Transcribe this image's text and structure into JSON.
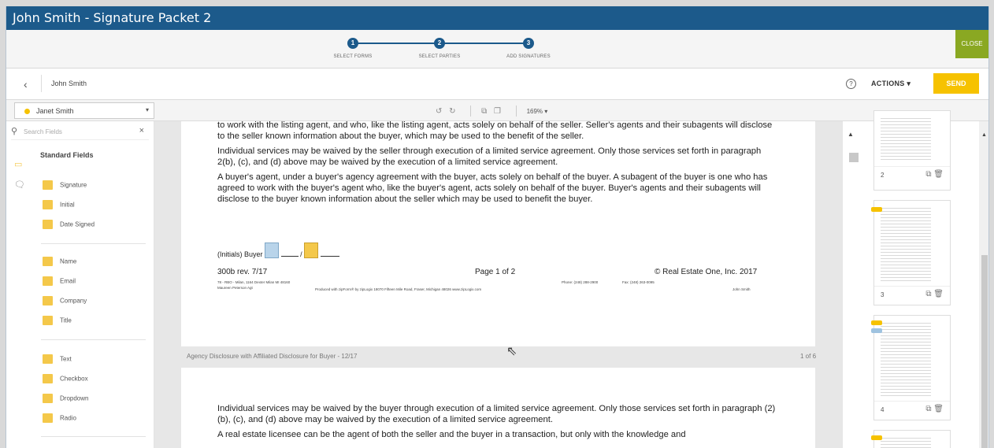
{
  "window_title": "John Smith - Signature Packet 2",
  "steps": [
    {
      "n": "1",
      "label": "SELECT FORMS"
    },
    {
      "n": "2",
      "label": "SELECT PARTIES"
    },
    {
      "n": "3",
      "label": "ADD SIGNATURES"
    }
  ],
  "close_label": "CLOSE",
  "nav": {
    "back_icon": "‹",
    "party": "John Smith",
    "help_icon": "?",
    "actions_label": "ACTIONS ▾",
    "send_label": "SEND"
  },
  "toolbar": {
    "signer": "Janet Smith",
    "undo": "↺",
    "redo": "↻",
    "copy": "⧉",
    "paste": "❐",
    "zoom": "169% ▾"
  },
  "sidebar": {
    "search_placeholder": "Search Fields",
    "clear": "×",
    "section": "Standard Fields",
    "fields": [
      "Signature",
      "Initial",
      "Date Signed",
      "Name",
      "Email",
      "Company",
      "Title",
      "Text",
      "Checkbox",
      "Dropdown",
      "Radio"
    ]
  },
  "doc": {
    "p1": "to work with the listing agent, and who, like the listing agent, acts solely on behalf of the seller. Seller's agents and their subagents will disclose to the seller known information about the buyer, which may be used to the benefit of the seller.",
    "p2": "Individual services may be waived by the seller through execution of a limited service agreement. Only those services set forth in paragraph 2(b), (c), and (d) above may be waived by the execution of a limited service agreement.",
    "p3": "A buyer's agent, under a buyer's agency agreement with the buyer, acts solely on behalf of the buyer. A subagent of the buyer is one who has agreed to work with the buyer's agent who, like the buyer's agent, acts solely on behalf of the buyer. Buyer's agents and their subagents will disclose to the buyer known information about the seller which may be used to benefit the buyer.",
    "initials": "(Initials) Buyer",
    "slash": "/",
    "rev": "300b rev. 7/17",
    "pageno": "Page 1 of 2",
    "copyright": "© Real Estate One, Inc. 2017",
    "tiny1": "78 - RBO - Milan, 1164 Dexter Milan MI 48160",
    "tiny2": "Maureen Peterson Agt",
    "tiny3": "Phone: (248) 288-2900",
    "tiny4": "Fax: (248) 263-0095",
    "tiny5": "Produced with zipForm® by zipLogix 18070 Fifteen Mile Road, Fraser, Michigan 48026 www.zipLogix.com",
    "tiny6": "John Smith",
    "caption": "Agency Disclosure with Affiliated Disclosure for Buyer - 12/17",
    "pageof": "1 of 6",
    "p4": "Individual services may be waived by the buyer through execution of a limited service agreement. Only those services set forth in paragraph (2)(b), (c), and (d) above may be waived by the execution of a limited service agreement.",
    "p5": "A real estate licensee can be the agent of both the seller and the buyer in a transaction, but only with the knowledge and"
  },
  "thumbs": [
    {
      "n": "2"
    },
    {
      "n": "3"
    },
    {
      "n": "4"
    }
  ],
  "colors": {
    "title": "#1c5a8b",
    "send": "#f6c200",
    "close": "#8aa822"
  }
}
